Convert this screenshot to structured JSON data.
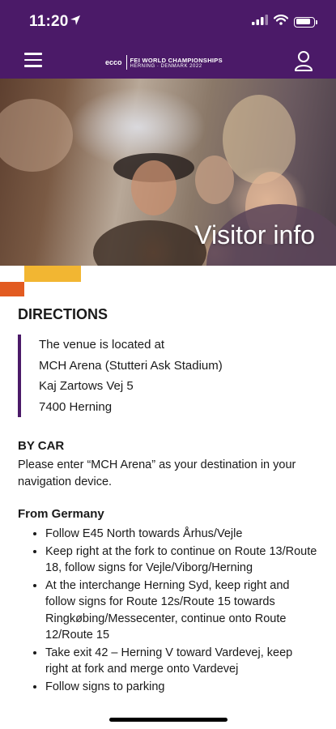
{
  "status_bar": {
    "time": "11:20",
    "icons": [
      "location-arrow-icon",
      "cellular-signal-icon",
      "wifi-icon",
      "battery-icon"
    ],
    "battery_level": 0.85
  },
  "header": {
    "menu_icon": "hamburger-menu-icon",
    "logo": {
      "brand": "ecco",
      "line1": "FEI WORLD CHAMPIONSHIPS",
      "line2": "HERNING · DENMARK 2022"
    },
    "user_icon": "user-account-icon"
  },
  "hero": {
    "title": "Visitor info"
  },
  "colors": {
    "brand_purple": "#4b1a68",
    "accent_yellow": "#f2b632",
    "accent_orange": "#e25b21"
  },
  "directions": {
    "heading": "DIRECTIONS",
    "address": [
      "The venue is located at",
      "MCH Arena (Stutteri Ask Stadium)",
      "Kaj Zartows Vej 5",
      "7400 Herning"
    ],
    "by_car_heading": "BY CAR",
    "by_car_text": "Please enter “MCH Arena” as your destination in your navigation device.",
    "from_germany_heading": "From Germany",
    "from_germany_steps": [
      "Follow E45 North towards Århus/Vejle",
      "Keep right at the fork to continue on Route 13/Route 18, follow signs for Vejle/Viborg/Herning",
      "At the interchange Herning Syd, keep right and follow signs for Route 12s/Route 15 towards Ringkøbing/Messecenter, continue onto Route 12/Route 15",
      "Take exit 42 – Herning V toward Vardevej, keep right at fork and merge onto Vardevej",
      "Follow signs to parking"
    ]
  }
}
